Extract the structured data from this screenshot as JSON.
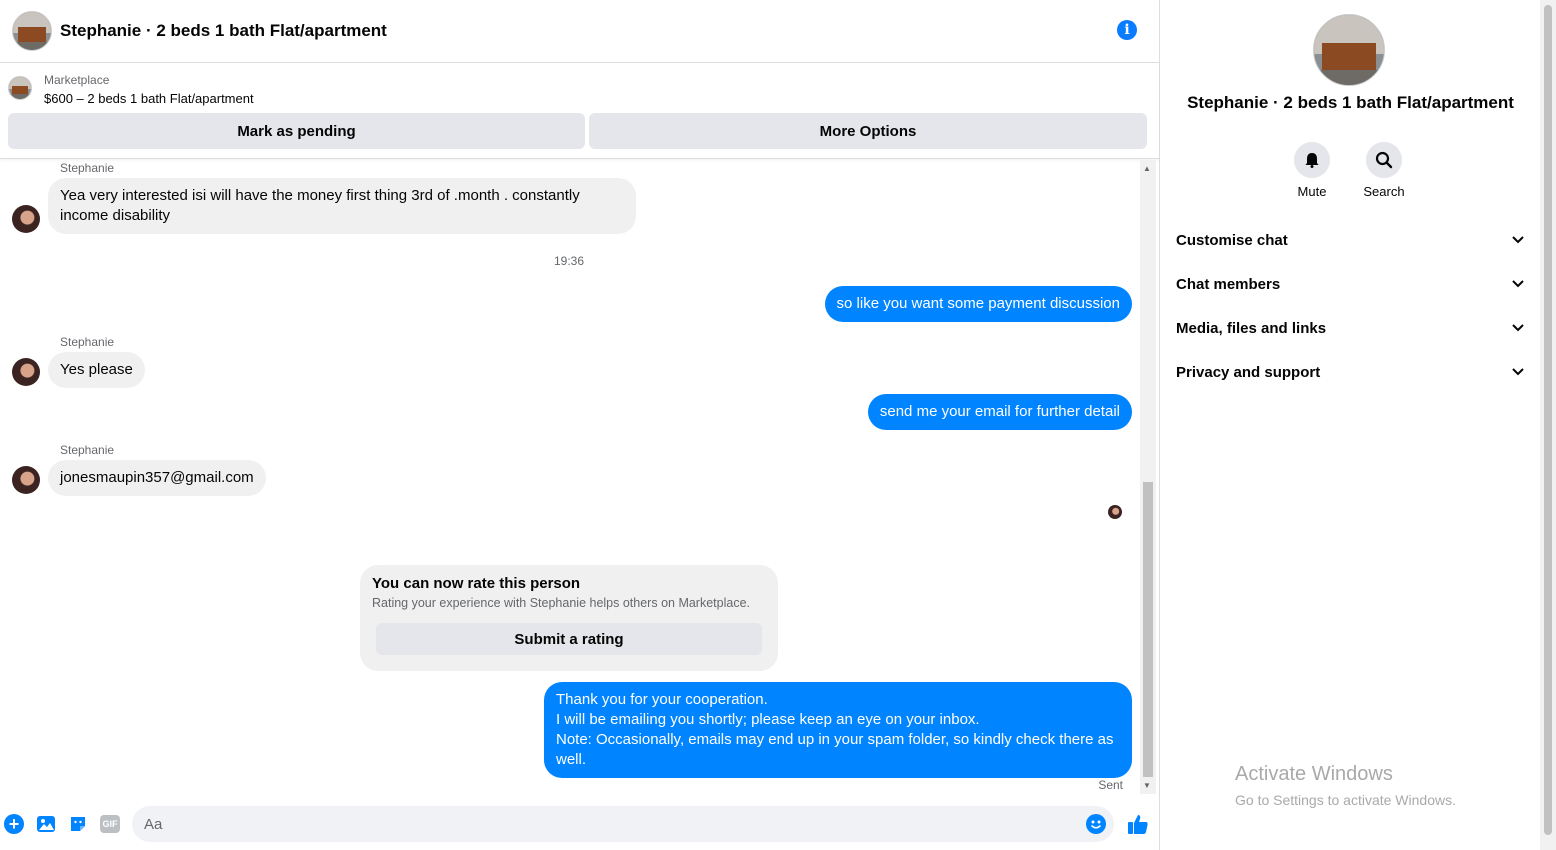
{
  "header": {
    "title": "Stephanie · 2 beds 1 bath Flat/apartment",
    "info_icon": "info-icon"
  },
  "listing": {
    "label": "Marketplace",
    "price_line": "$600 – 2 beds 1 bath Flat/apartment",
    "mark_pending": "Mark as pending",
    "more_options": "More Options"
  },
  "messages": {
    "m1": {
      "sender": "Stephanie",
      "text": "Yea very interested isi will have the money first thing 3rd of .month . constantly income disability"
    },
    "time1": "19:36",
    "m2": {
      "text": "so like you want some payment discussion"
    },
    "m3": {
      "sender": "Stephanie",
      "text": "Yes please"
    },
    "m4": {
      "text": "send me your email for further detail"
    },
    "m5": {
      "sender": "Stephanie",
      "text": "jonesmaupin357@gmail.com"
    },
    "rate": {
      "title": "You can now rate this person",
      "subtitle": "Rating your experience with Stephanie helps others on Marketplace.",
      "button": "Submit a rating"
    },
    "m6": {
      "lines": [
        "Thank you for your cooperation.",
        "I will be emailing you shortly; please keep an eye on your inbox.",
        "Note: Occasionally, emails may end up in your spam folder, so kindly check there as well."
      ]
    },
    "status": "Sent"
  },
  "composer": {
    "placeholder": "Aa",
    "gif_label": "GIF",
    "icons": [
      "plus-icon",
      "photo-icon",
      "sticker-icon",
      "gif-icon",
      "emoji-icon",
      "thumbs-up-icon"
    ]
  },
  "sidebar": {
    "title": "Stephanie · 2 beds 1 bath Flat/apartment",
    "mute": "Mute",
    "search": "Search",
    "sections": [
      "Customise chat",
      "Chat members",
      "Media, files and links",
      "Privacy and support"
    ]
  },
  "watermark": {
    "line1": "Activate Windows",
    "line2": "Go to Settings to activate Windows."
  },
  "colors": {
    "accent": "#0084ff",
    "bubble_in": "#f0f0f0",
    "button_gray": "#e4e6eb"
  }
}
